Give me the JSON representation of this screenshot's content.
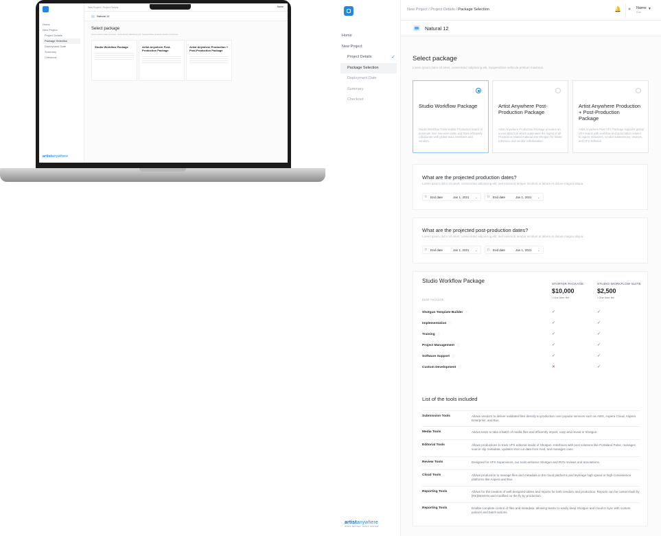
{
  "laptop": {
    "breadcrumb": "New Project / Project Details",
    "user": "Name",
    "nav": [
      {
        "label": "Home",
        "sub": false,
        "active": false
      },
      {
        "label": "New Project",
        "sub": false,
        "active": false
      },
      {
        "label": "Project Details",
        "sub": true,
        "active": false
      },
      {
        "label": "Package Selection",
        "sub": true,
        "active": true
      },
      {
        "label": "Deployment Date",
        "sub": true,
        "active": false
      },
      {
        "label": "Summary",
        "sub": true,
        "active": false
      },
      {
        "label": "Checkout",
        "sub": true,
        "active": false
      }
    ],
    "project": "Natural 12",
    "title": "Select package",
    "cards": [
      "Studio Workflow Package",
      "Artist Anywhere Post-Production Package",
      "Artist Anywhere Production + Post-Production Package"
    ],
    "brand": {
      "bold": "artist",
      "rest": "anywhere"
    }
  },
  "sidebar": {
    "nav": [
      {
        "label": "Home",
        "sub": false,
        "active": false,
        "muted": false,
        "done": false
      },
      {
        "label": "New Project",
        "sub": false,
        "active": false,
        "muted": false,
        "done": false
      },
      {
        "label": "Project Details",
        "sub": true,
        "active": false,
        "muted": false,
        "done": true
      },
      {
        "label": "Package Selection",
        "sub": true,
        "active": true,
        "muted": false,
        "done": false
      },
      {
        "label": "Deployment Date",
        "sub": true,
        "active": false,
        "muted": true,
        "done": false
      },
      {
        "label": "Summary",
        "sub": true,
        "active": false,
        "muted": true,
        "done": false
      },
      {
        "label": "Checkout",
        "sub": true,
        "active": false,
        "muted": true,
        "done": false
      }
    ],
    "brand": {
      "bold": "artist",
      "rest": "anywhere",
      "tagline": "WORK BETTER, WORK FASTER"
    }
  },
  "header": {
    "breadcrumb_prefix": "New Project / Project Details / ",
    "breadcrumb_current": "Package Selection",
    "user_name": "Name",
    "user_role": "Role"
  },
  "project": {
    "name": "Natural 12"
  },
  "select": {
    "title": "Select package",
    "description": "Lorem ipsum dolor sit amet, consectetur adipiscing elit. Suspendisse vehicula pretium maximus.",
    "cards": [
      {
        "title": "Studio Workflow Package",
        "desc": "Studio Workflow Tools enable Production teams to automate time intensive tasks and more efficiently collaborate with global team members and vendors.",
        "selected": true
      },
      {
        "title": "Artist Anywhere Post-Production Package",
        "desc": "Artist Anywhere Production Package provides an on-set data hub which automates the ingest of all Production related material into Shotgun for future reference and vendor collaboration.",
        "selected": false
      },
      {
        "title": "Artist Anywhere Production + Post-Production Package",
        "desc": "Artist Anywhere Post VFX Package supports global VFX teams with workflow and automation related to ingest, deliveries, vendor submissions, reviews, and VFX Editorial.",
        "selected": false
      }
    ]
  },
  "production_dates": {
    "title": "What are the projected production dates?",
    "description": "Lorem ipsum dolor sit amet, consectetur adipiscing elit, sed eiusmod tempor incidunt ut labore et dolore magna aliqua.",
    "fields": [
      {
        "label": "End date",
        "value": "Jan 1, 2021"
      },
      {
        "label": "End date",
        "value": "Jan 1, 2021"
      }
    ]
  },
  "post_dates": {
    "title": "What are the projected post-production dates?",
    "description": "Lorem ipsum dolor sit amet, consectetur adipiscing elit, sed eiusmod tempor incidunt ut labore et dolore magna aliqua.",
    "fields": [
      {
        "label": "End date",
        "value": "Jan 1, 2021"
      },
      {
        "label": "End date",
        "value": "Jan 1, 2021"
      }
    ]
  },
  "package": {
    "title": "Studio Workflow Package",
    "base_label": "BASE PACKAGE",
    "tiers": [
      {
        "name": "STARTER PACKAGE",
        "price": "$10,000",
        "fee": "/ One time fee"
      },
      {
        "name": "STUDIO WORKFLOW SUITE",
        "price": "$2,500",
        "fee": "/ One time fee"
      }
    ],
    "features": [
      {
        "name": "Shotgun Template Builder",
        "starter": true,
        "suite": true
      },
      {
        "name": "Implementation",
        "starter": true,
        "suite": true
      },
      {
        "name": "Training",
        "starter": true,
        "suite": true
      },
      {
        "name": "Project Management",
        "starter": true,
        "suite": true
      },
      {
        "name": "Software Support",
        "starter": true,
        "suite": true
      },
      {
        "name": "Custom Development",
        "starter": false,
        "suite": true
      }
    ],
    "tools_title": "List of the tools included",
    "tools": [
      {
        "name": "Submission Tools",
        "desc": "Allows vendors to deliver validated files directly to production over popular services such as AWS, Aspera Cloud, Aspera Enterprise, and Box."
      },
      {
        "name": "Media Tools",
        "desc": "Allows team to take a batch of media files and efficiently import, copy and reveal in Shotgun."
      },
      {
        "name": "Editorial Tools",
        "desc": "Allows productions to track VFX editorial inside of Shotgun. Interfaces with post solutions like Portaland Pulse, manages source clip metadata, updates shot cut data from Avid, and manages cans."
      },
      {
        "name": "Review Tools",
        "desc": "Designed for VFX Supervisors, our tools enhance Shotgun and RV's reviews and annotations."
      },
      {
        "name": "Cloud Tools",
        "desc": "Allows production to manage files and metadata in the cloud platforms and leverage high speed or high-convenience platforms like Aspera and Box."
      },
      {
        "name": "Reporting Tools",
        "desc": "Allows for the creation of well-designed tables and reports for both vendors and production. Reports can be custom-built by [RE]DESIGN and modified on the fly by production."
      },
      {
        "name": "Reporting Tools",
        "desc": "Enable complete control of files and metadata, allowing teams to easily keep Shotgun and cloud in sync with custom policies and batch actions."
      }
    ]
  },
  "colors": {
    "accent": "#1e88e5",
    "check": "#1e88e5",
    "cross": "#e53935"
  }
}
